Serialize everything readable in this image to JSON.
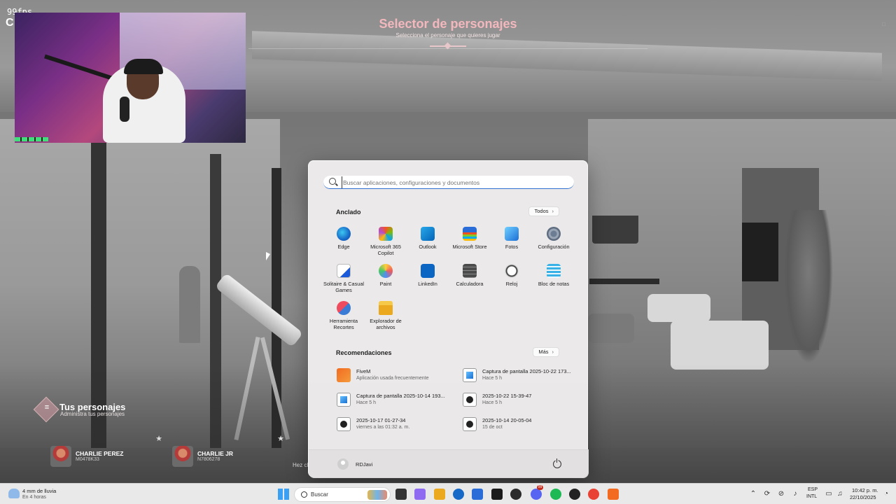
{
  "hud": {
    "fps": "99fps",
    "title": "Selector de personajes",
    "subtitle": "Selecciona el personaje que quieres jugar",
    "characters_title": "Tus personajes",
    "characters_subtitle": "Administra tus personajes",
    "characters": [
      {
        "name": "CHARLIE PEREZ",
        "id": "M0478K33"
      },
      {
        "name": "CHARLIE JR",
        "id": "N7806278"
      }
    ],
    "hint": "Hez cli"
  },
  "start_menu": {
    "search_placeholder": "Buscar aplicaciones, configuraciones y documentos",
    "pinned_title": "Anclado",
    "all_button": "Todos",
    "pinned_apps": [
      {
        "label": "Edge",
        "icon": "edge-icon"
      },
      {
        "label": "Microsoft 365 Copilot",
        "icon": "copilot-icon"
      },
      {
        "label": "Outlook",
        "icon": "outlook-icon"
      },
      {
        "label": "Microsoft Store",
        "icon": "store-icon"
      },
      {
        "label": "Fotos",
        "icon": "photos-icon"
      },
      {
        "label": "Configuración",
        "icon": "gear-icon"
      },
      {
        "label": "Solitaire & Casual Games",
        "icon": "cards-icon"
      },
      {
        "label": "Paint",
        "icon": "paint-icon"
      },
      {
        "label": "LinkedIn",
        "icon": "linkedin-icon"
      },
      {
        "label": "Calculadora",
        "icon": "calculator-icon"
      },
      {
        "label": "Reloj",
        "icon": "clock-icon"
      },
      {
        "label": "Bloc de notas",
        "icon": "notepad-icon"
      },
      {
        "label": "Herramienta Recortes",
        "icon": "snipping-tool-icon"
      },
      {
        "label": "Explorador de archivos",
        "icon": "folder-icon"
      }
    ],
    "recommended_title": "Recomendaciones",
    "more_button": "Más",
    "recommended": [
      {
        "title": "FiveM",
        "subtitle": "Aplicación usada frecuentemente",
        "icon": "fivem-icon"
      },
      {
        "title": "Captura de pantalla 2025-10-22 173...",
        "subtitle": "Hace 5 h",
        "icon": "image-file-icon"
      },
      {
        "title": "Captura de pantalla 2025-10-14 193...",
        "subtitle": "Hace 5 h",
        "icon": "image-file-icon"
      },
      {
        "title": "2025-10-22 15-39-47",
        "subtitle": "Hace 5 h",
        "icon": "video-file-icon"
      },
      {
        "title": "2025-10-17 01-27-34",
        "subtitle": "viernes a las 01:32 a. m.",
        "icon": "video-file-icon"
      },
      {
        "title": "2025-10-14 20-05-04",
        "subtitle": "15 de oct",
        "icon": "video-file-icon"
      }
    ],
    "user_name": "RDJavi"
  },
  "taskbar": {
    "weather_line1": "4 mm de lluvia",
    "weather_line2": "En 4 horas",
    "search_label": "Buscar",
    "apps": [
      {
        "icon": "task-view-icon",
        "color": "#333333"
      },
      {
        "icon": "copilot-icon",
        "color": "#8e6bf0"
      },
      {
        "icon": "file-explorer-icon",
        "color": "#eaa91e"
      },
      {
        "icon": "edge-icon",
        "color": "#1769c8"
      },
      {
        "icon": "store-icon",
        "color": "#2a6cd8"
      },
      {
        "icon": "terminal-icon",
        "color": "#1b1b1b"
      },
      {
        "icon": "obs-icon",
        "color": "#2b2b2b"
      },
      {
        "icon": "discord-icon",
        "color": "#5865f2",
        "badge": "99"
      },
      {
        "icon": "spotify-icon",
        "color": "#1db954"
      },
      {
        "icon": "app-dark-icon",
        "color": "#222222"
      },
      {
        "icon": "chrome-icon",
        "color": "#e94235"
      },
      {
        "icon": "fivem-icon",
        "color": "#f26b21"
      }
    ],
    "lang_1": "ESP",
    "lang_2": "INTL",
    "time": "10:42 p. m.",
    "date": "22/10/2025"
  }
}
